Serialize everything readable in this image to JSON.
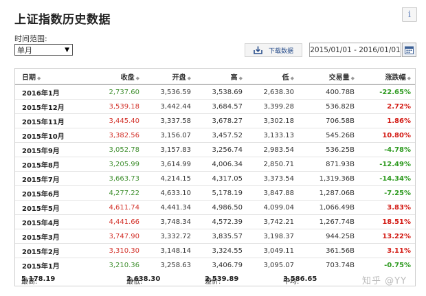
{
  "title": "上证指数历史数据",
  "info_icon": "i",
  "range": {
    "label": "时间范围:",
    "selected": "单月"
  },
  "download_label": "下载数据",
  "date_range": "2015/01/01 - 2016/01/01",
  "columns": [
    "日期",
    "收盘",
    "开盘",
    "高",
    "低",
    "交易量",
    "涨跌幅"
  ],
  "rows": [
    {
      "date": "2016年1月",
      "close": "2,737.60",
      "open": "3,536.59",
      "high": "3,538.69",
      "low": "2,638.30",
      "volume": "400.78B",
      "change": "-22.65%",
      "trend": "down"
    },
    {
      "date": "2015年12月",
      "close": "3,539.18",
      "open": "3,442.44",
      "high": "3,684.57",
      "low": "3,399.28",
      "volume": "536.82B",
      "change": "2.72%",
      "trend": "up"
    },
    {
      "date": "2015年11月",
      "close": "3,445.40",
      "open": "3,337.58",
      "high": "3,678.27",
      "low": "3,302.18",
      "volume": "706.58B",
      "change": "1.86%",
      "trend": "up"
    },
    {
      "date": "2015年10月",
      "close": "3,382.56",
      "open": "3,156.07",
      "high": "3,457.52",
      "low": "3,133.13",
      "volume": "545.26B",
      "change": "10.80%",
      "trend": "up"
    },
    {
      "date": "2015年9月",
      "close": "3,052.78",
      "open": "3,157.83",
      "high": "3,256.74",
      "low": "2,983.54",
      "volume": "536.25B",
      "change": "-4.78%",
      "trend": "down"
    },
    {
      "date": "2015年8月",
      "close": "3,205.99",
      "open": "3,614.99",
      "high": "4,006.34",
      "low": "2,850.71",
      "volume": "871.93B",
      "change": "-12.49%",
      "trend": "down"
    },
    {
      "date": "2015年7月",
      "close": "3,663.73",
      "open": "4,214.15",
      "high": "4,317.05",
      "low": "3,373.54",
      "volume": "1,319.36B",
      "change": "-14.34%",
      "trend": "down"
    },
    {
      "date": "2015年6月",
      "close": "4,277.22",
      "open": "4,633.10",
      "high": "5,178.19",
      "low": "3,847.88",
      "volume": "1,287.06B",
      "change": "-7.25%",
      "trend": "down"
    },
    {
      "date": "2015年5月",
      "close": "4,611.74",
      "open": "4,441.34",
      "high": "4,986.50",
      "low": "4,099.04",
      "volume": "1,066.49B",
      "change": "3.83%",
      "trend": "up"
    },
    {
      "date": "2015年4月",
      "close": "4,441.66",
      "open": "3,748.34",
      "high": "4,572.39",
      "low": "3,742.21",
      "volume": "1,267.74B",
      "change": "18.51%",
      "trend": "up"
    },
    {
      "date": "2015年3月",
      "close": "3,747.90",
      "open": "3,332.72",
      "high": "3,835.57",
      "low": "3,198.37",
      "volume": "944.25B",
      "change": "13.22%",
      "trend": "up"
    },
    {
      "date": "2015年2月",
      "close": "3,310.30",
      "open": "3,148.14",
      "high": "3,324.55",
      "low": "3,049.11",
      "volume": "361.56B",
      "change": "3.11%",
      "trend": "up"
    },
    {
      "date": "2015年1月",
      "close": "3,210.36",
      "open": "3,258.63",
      "high": "3,406.79",
      "low": "3,095.07",
      "volume": "703.74B",
      "change": "-0.75%",
      "trend": "down"
    }
  ],
  "summary": {
    "high_label": "最高:",
    "high": "5,178.19",
    "low_label": "最低:",
    "low": "2,638.30",
    "diff_label": "差价:",
    "diff": "2,539.89",
    "avg_label": "平均:",
    "avg": "3,586.65"
  },
  "watermark": "知乎 @YY",
  "colors": {
    "up": "#d31b14",
    "down": "#2e9a20",
    "link": "#2a4f8c"
  },
  "icons": [
    "info-icon",
    "sort-icon",
    "download-icon",
    "calendar-icon",
    "dropdown-caret-icon"
  ]
}
